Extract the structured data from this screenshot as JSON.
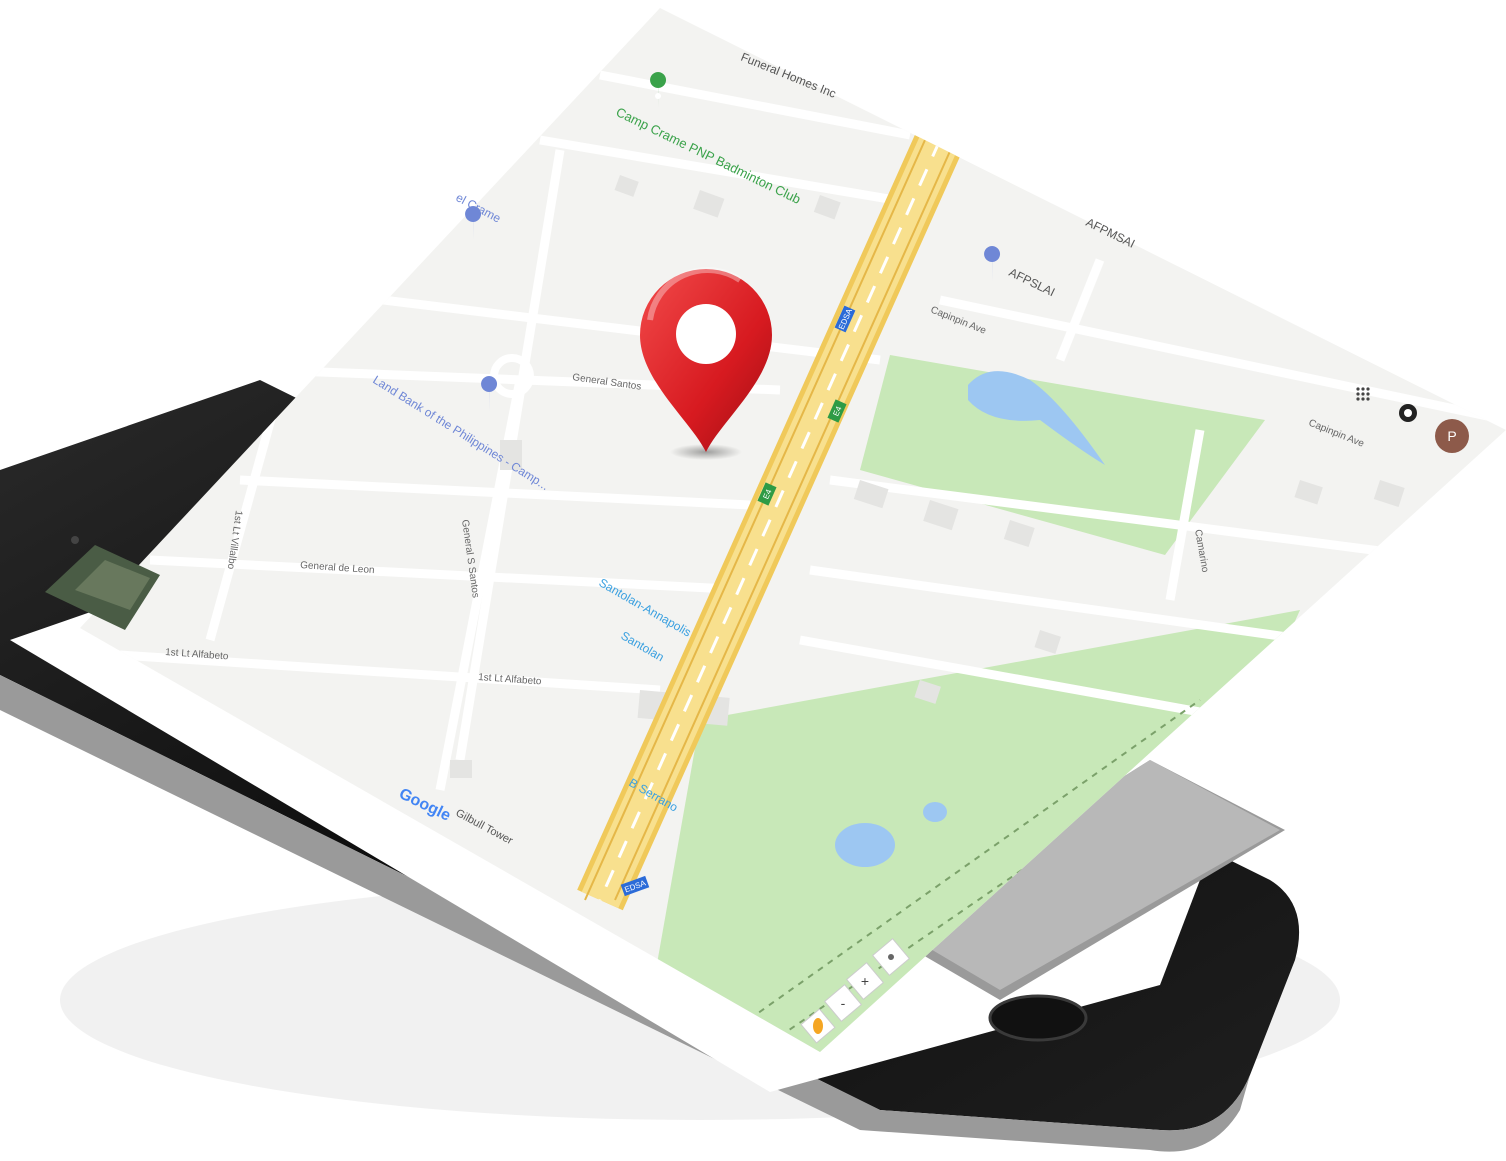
{
  "map": {
    "labels": {
      "funeral_homes": "Funeral Homes Inc",
      "camp_crame_badminton": "Camp Crame PNP Badminton Club",
      "camp_crame": "el Crame",
      "afpsmi_top": "AFPMSAI",
      "afpslai": "AFPSLAI",
      "capinpin_ave_1": "Capinpin Ave",
      "capinpin_ave_2": "Capinpin Ave",
      "general_santos": "General Santos",
      "land_bank": "Land Bank of the Philippines - Camp...",
      "general_de_leon": "General de Leon",
      "general_s_santos": "General S Santos",
      "lt_ildefonso": "1st Lt Villalbo",
      "1st_lt_alfabeto_left": "1st Lt Alfabeto",
      "1st_lt_alfabeto_mid": "1st Lt Alfabeto",
      "santolan_annapolis": "Santolan-Annapolis",
      "santolan": "Santolan",
      "b_serrano": "B Serrano",
      "camarin": "Camarino",
      "gilbull_tower": "Gilbull Tower",
      "google_logo": "Google"
    },
    "road_shields": [
      "EDSA",
      "E4",
      "E4",
      "EDSA"
    ],
    "controls": {
      "zoom_in": "+",
      "zoom_out": "-"
    },
    "avatar_letter": "P",
    "colors": {
      "park": "#c8e8b8",
      "highway": "#f5d97e",
      "pin": "#d71a20",
      "water": "#9dc7f2",
      "transit_label": "#3aa0e0",
      "poi_green": "#3aa24a",
      "poi_blue": "#6f87d6",
      "avatar": "#8d5a4a"
    }
  }
}
